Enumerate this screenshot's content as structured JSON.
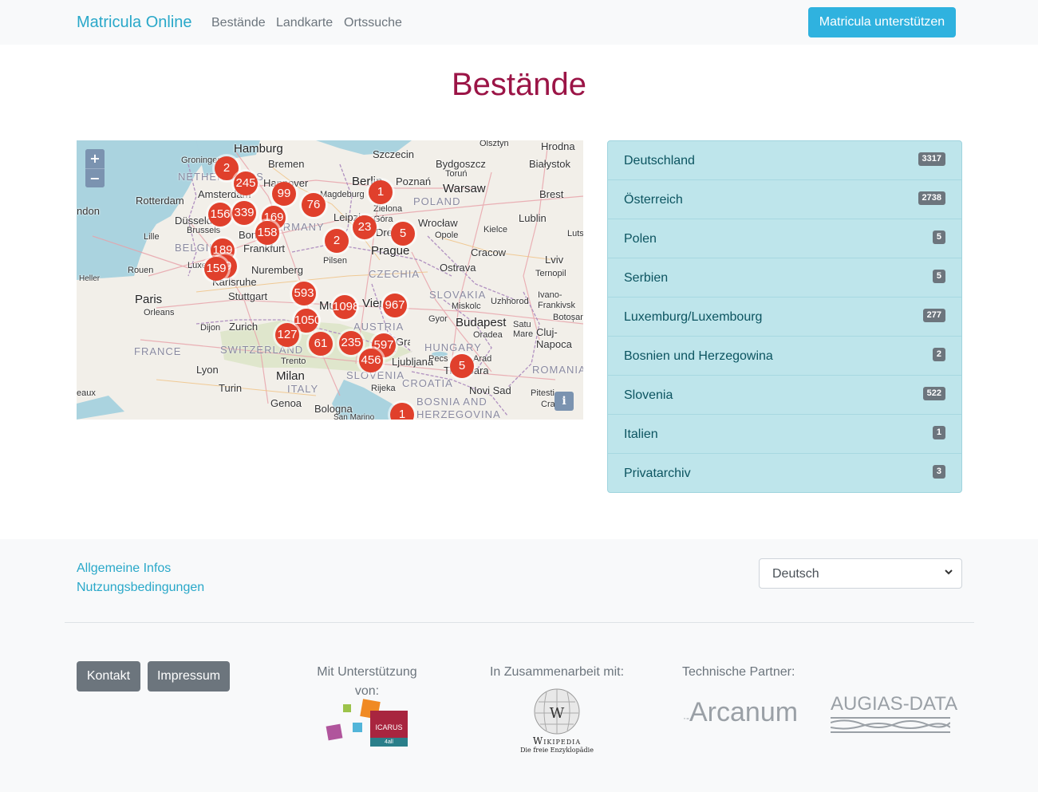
{
  "navbar": {
    "brand": "Matricula Online",
    "links": [
      "Bestände",
      "Landkarte",
      "Ortssuche"
    ],
    "support_button": "Matricula unterstützen"
  },
  "page": {
    "title": "Bestände"
  },
  "map": {
    "zoom_in": "+",
    "zoom_out": "−",
    "info": "i",
    "cities": [
      "Hamburg",
      "Groningen",
      "Bremen",
      "Szczecin",
      "Olsztyn",
      "Hrodna",
      "Bydgoszcz",
      "Białystok",
      "Toruń",
      "Amsterdam",
      "Hannover",
      "Berlin",
      "Poznań",
      "Warsaw",
      "Brest",
      "Rotterdam",
      "Magdeburg",
      "ndon",
      "Düsseldorf",
      "Leipzig",
      "Zielona Góra",
      "Wrocław",
      "Lublin",
      "Dresden",
      "Opole",
      "Kielce",
      "Lille",
      "Brussels",
      "Bonn",
      "Frankfurt",
      "Lutsk",
      "Pilsen",
      "Prague",
      "Cracow",
      "Lviv",
      "Heller",
      "Rouen",
      "Luxembourg",
      "Nuremberg",
      "Ostrava",
      "Ternopil",
      "Karlsruhe",
      "Paris",
      "Stuttgart",
      "Ivano-Frankivsk",
      "Orleans",
      "Munich",
      "Vienna",
      "Uzhhorod",
      "Miskolc",
      "Gyor",
      "Budapest",
      "Satu Mare",
      "Botoșani",
      "Dijon",
      "Zurich",
      "Oradea",
      "Cluj-Napoca",
      "Graz",
      "Lyon",
      "Trento",
      "Ljubljana",
      "Pecs",
      "Arad",
      "Timișoara",
      "Milan",
      "Turin",
      "Rijeka",
      "Novi Sad",
      "Pitesti",
      "Craiova",
      "eaux",
      "Genoa",
      "Bologna",
      "San Marino"
    ],
    "countries": [
      "NETHERLANDS",
      "GERMANY",
      "POLAND",
      "BELGIUM",
      "CZECHIA",
      "SLOVAKIA",
      "FRANCE",
      "AUSTRIA",
      "HUNGARY",
      "SWITZERLAND",
      "SLOVENIA",
      "ROMANIA",
      "ITALY",
      "CROATIA",
      "BOSNIA AND",
      "HERZEGOVINA"
    ],
    "clusters": [
      "2",
      "245",
      "99",
      "76",
      "1",
      "156",
      "339",
      "169",
      "23",
      "5",
      "158",
      "2",
      "189",
      "39",
      "159",
      "593",
      "1098",
      "967",
      "1050",
      "127",
      "61",
      "235",
      "597",
      "456",
      "5",
      "1"
    ]
  },
  "holdings": [
    {
      "name": "Deutschland",
      "count": "3317"
    },
    {
      "name": "Österreich",
      "count": "2738"
    },
    {
      "name": "Polen",
      "count": "5"
    },
    {
      "name": "Serbien",
      "count": "5"
    },
    {
      "name": "Luxemburg/Luxembourg",
      "count": "277"
    },
    {
      "name": "Bosnien und Herzegowina",
      "count": "2"
    },
    {
      "name": "Slovenia",
      "count": "522"
    },
    {
      "name": "Italien",
      "count": "1"
    },
    {
      "name": "Privatarchiv",
      "count": "3"
    }
  ],
  "footer": {
    "links": [
      "Allgemeine Infos",
      "Nutzungsbedingungen"
    ],
    "language": "Deutsch",
    "buttons": [
      "Kontakt",
      "Impressum"
    ],
    "support_heading": "Mit Unterstützung von:",
    "support_logo_text": [
      "ICARUS",
      "4all"
    ],
    "cooperation_heading": "In Zusammenarbeit mit:",
    "wikipedia_text": [
      "Wikipedia",
      "Die freie Enzyklopädie"
    ],
    "tech_heading": "Technische Partner:",
    "tech_partners": [
      "Arcanum",
      "AUGIAS-DATA"
    ]
  },
  "colors": {
    "brand": "#29a8c9",
    "title": "#9b1446",
    "marker": "#e0402c",
    "list_bg": "#bee5eb",
    "support_button": "#2fb2df"
  }
}
